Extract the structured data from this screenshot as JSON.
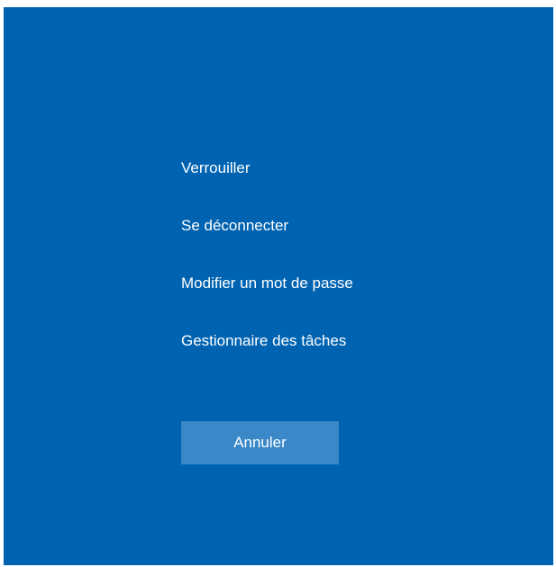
{
  "colors": {
    "background": "#0063b1",
    "button": "#3a88c8",
    "text": "#ffffff"
  },
  "menu": {
    "items": [
      {
        "label": "Verrouiller"
      },
      {
        "label": "Se déconnecter"
      },
      {
        "label": "Modifier un mot de passe"
      },
      {
        "label": "Gestionnaire des tâches"
      }
    ]
  },
  "cancel_button": {
    "label": "Annuler"
  }
}
